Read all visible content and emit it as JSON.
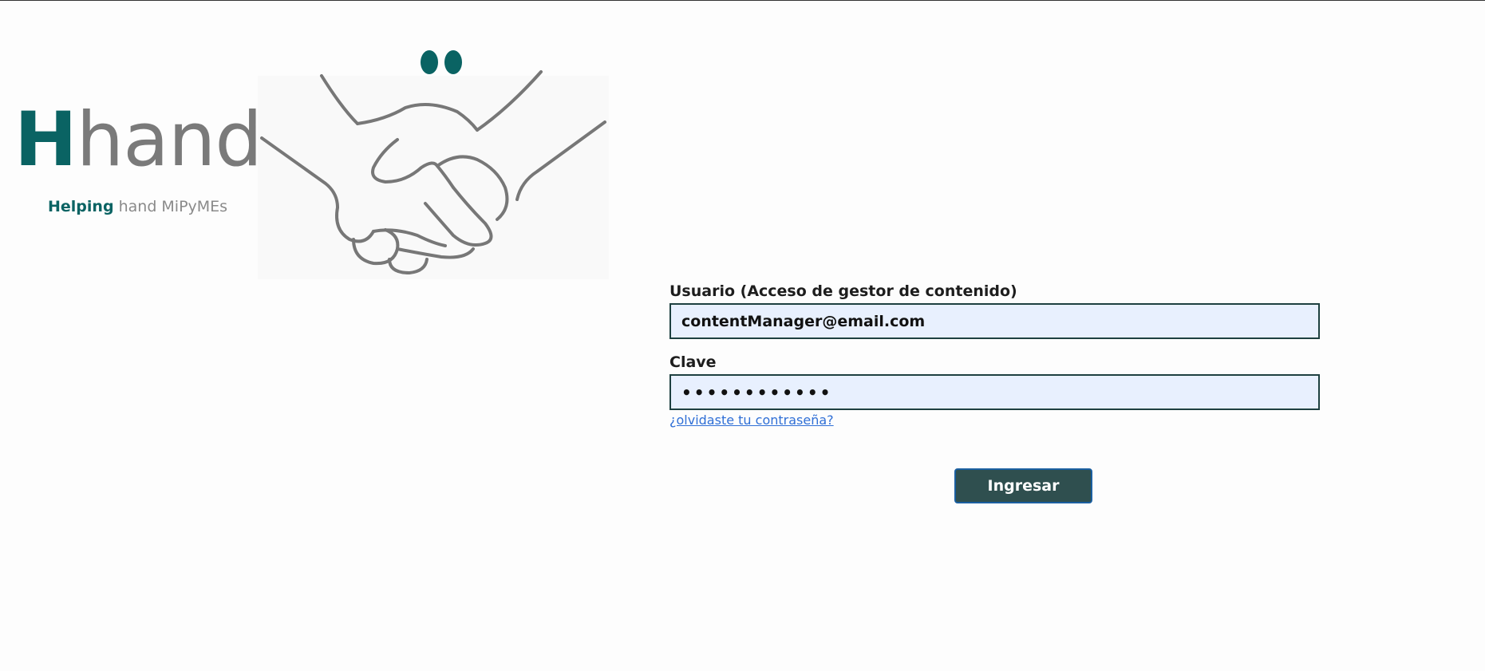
{
  "logo": {
    "brand_initial": "H",
    "brand_rest": "hand",
    "tagline_bold": "Helping",
    "tagline_rest": " hand MiPyMEs",
    "icon": "handshake-icon"
  },
  "login_form": {
    "username_label": "Usuario (Acceso de gestor de contenido)",
    "username_value": "contentManager@email.com",
    "password_label": "Clave",
    "password_value": "••••••••••••",
    "forgot_link": "¿olvidaste tu contraseña?",
    "submit_label": "Ingresar"
  },
  "colors": {
    "brand_teal": "#0a6363",
    "brand_gray": "#7a7a7a",
    "button_bg": "#2f4f4f",
    "input_bg": "#e8f0fe",
    "link": "#2f6fd6"
  }
}
